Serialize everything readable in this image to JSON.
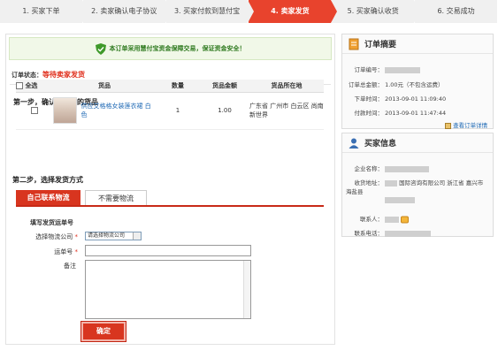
{
  "steps": [
    "1. 买家下单",
    "2. 卖家确认电子协议",
    "3. 买家付款到慧付宝",
    "4. 卖家发货",
    "5. 买家确认收货",
    "6. 交易成功"
  ],
  "active_step": 3,
  "safe_notice": "本订单采用慧付宝资金保障交易，保证资金安全！",
  "status": {
    "label": "订单状态：",
    "value": "等待卖家发货"
  },
  "step1_title": "第一步，确认要发货的货品",
  "goods_table": {
    "headers": {
      "select_all": "全选",
      "goods": "货品",
      "qty": "数量",
      "amount": "货品金额",
      "location": "货品所在地"
    },
    "rows": [
      {
        "name": "供应艾格格女装莲衣裙  白色",
        "qty": "1",
        "amount": "1.00",
        "location": "广东省 广州市 白云区 尚南新世界"
      }
    ]
  },
  "step2_title": "第二步，选择发货方式",
  "tabs": {
    "logistics": "自己联系物流",
    "no_logistics": "不需要物流"
  },
  "form": {
    "title": "填写发货运单号",
    "company_label": "选择物流公司",
    "company_value": "请选择物流公司",
    "waybill_label": "运单号",
    "remark_label": "备注",
    "confirm": "确定"
  },
  "order_summary": {
    "title": "订单摘要",
    "order_no_label": "订单编号：",
    "total_label": "订单总金额：",
    "total_value": "1.00元（不包含运费）",
    "order_time_label": "下单时间：",
    "order_time": "2013-09-01 11:09:40",
    "pay_time_label": "付款时间：",
    "pay_time": "2013-09-01 11:47:44",
    "detail_link": "查看订单详情"
  },
  "buyer_info": {
    "title": "买家信息",
    "company_label": "企业名称：",
    "address_label": "收货地址：",
    "address_value": "国际咨询有限公司 浙江省 嘉兴市 海盐县",
    "contact_label": "联系人：",
    "phone_label": "联系电话："
  }
}
